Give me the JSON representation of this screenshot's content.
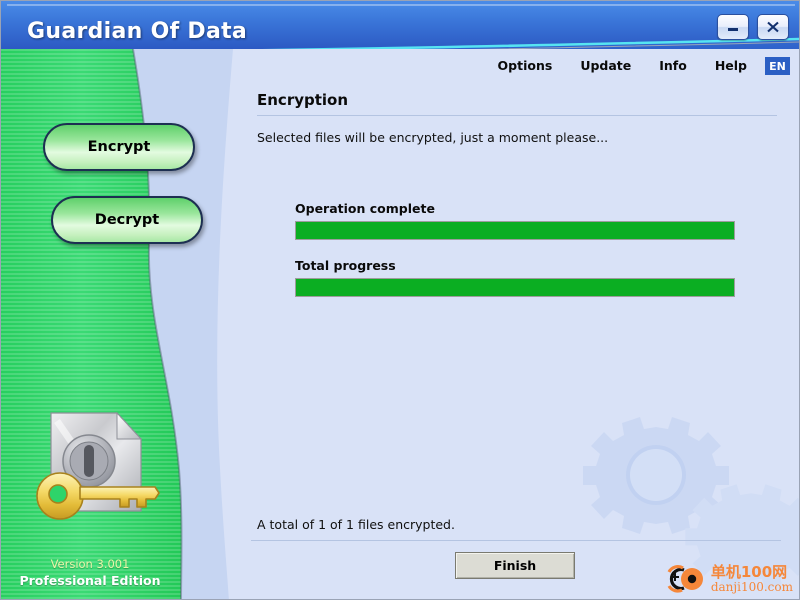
{
  "window": {
    "title": "Guardian Of Data",
    "minimize_label": "Minimize",
    "close_label": "Close"
  },
  "menu": {
    "items": [
      {
        "label": "Options"
      },
      {
        "label": "Update"
      },
      {
        "label": "Info"
      },
      {
        "label": "Help"
      }
    ],
    "language_badge": "EN"
  },
  "sidebar": {
    "buttons": [
      {
        "label": "Encrypt"
      },
      {
        "label": "Decrypt"
      }
    ],
    "version": "Version 3.001",
    "edition": "Professional Edition",
    "logo_name": "document-key-logo"
  },
  "main": {
    "heading": "Encryption",
    "subtitle": "Selected files will be encrypted, just a moment please...",
    "progress": [
      {
        "label": "Operation complete",
        "percent": 100
      },
      {
        "label": "Total progress",
        "percent": 100
      }
    ],
    "status_text": "A total of 1 of 1 files encrypted.",
    "finish_label": "Finish"
  },
  "watermark": {
    "cn": "单机100网",
    "en": "danji100.com"
  },
  "colors": {
    "title_blue": "#3a7ede",
    "sidebar_green": "#2ed46a",
    "panel_blue": "#d9e2f7",
    "band_blue": "#c6d5f2",
    "progress_green": "#0bae22",
    "badge_blue": "#2b5fc4",
    "watermark_orange": "#f5873a"
  }
}
